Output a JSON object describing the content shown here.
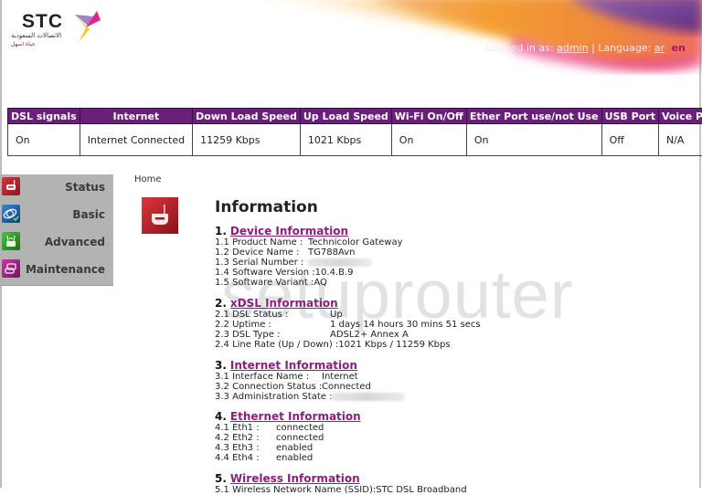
{
  "header": {
    "brand": "STC",
    "brand_arabic": "الاتصالات السعودية",
    "tagline_arabic": "حياة اسهل",
    "logged_in_prefix": "Logged in as:",
    "user": "admin",
    "separator": "|",
    "language_label": "Language:",
    "languages": [
      "ar",
      "en"
    ],
    "active_language": "en"
  },
  "status_table": {
    "headers": [
      "DSL signals",
      "Internet",
      "Down Load Speed",
      "Up Load Speed",
      "Wi-Fi On/Off",
      "Ether Port use/not Use",
      "USB Port",
      "Voice Port"
    ],
    "values": [
      "On",
      "Internet Connected",
      "11259 Kbps",
      "1021 Kbps",
      "On",
      "On",
      "Off",
      "N/A"
    ]
  },
  "sidebar": {
    "items": [
      {
        "label": "Status",
        "icon": "router-icon",
        "color": "#b0212b"
      },
      {
        "label": "Basic",
        "icon": "globe-check-icon",
        "color": "#1d5ea8"
      },
      {
        "label": "Advanced",
        "icon": "router-antenna-icon",
        "color": "#2e9a2a"
      },
      {
        "label": "Maintenance",
        "icon": "tools-icon",
        "color": "#a3248a"
      }
    ]
  },
  "main": {
    "breadcrumb": "Home",
    "title": "Information",
    "watermark": "setuprouter",
    "sections": [
      {
        "number": "1.",
        "title": "Device Information",
        "rows": [
          {
            "label": "1.1 Product Name :",
            "value": "Technicolor Gateway"
          },
          {
            "label": "1.2 Device Name :",
            "value": "TG788Avn"
          },
          {
            "label": "1.3 Serial Number :",
            "value": ""
          },
          {
            "label": "1.4 Software Version :",
            "value": "10.4.B.9"
          },
          {
            "label": "1.5 Software Variant :",
            "value": "AQ"
          }
        ]
      },
      {
        "number": "2.",
        "title": "xDSL Information",
        "rows": [
          {
            "label": "2.1 DSL Status :",
            "value": "Up"
          },
          {
            "label": "2.2 Uptime :",
            "value": "1 days 14 hours 30 mins 51 secs"
          },
          {
            "label": "2.3 DSL Type :",
            "value": "ADSL2+ Annex A"
          },
          {
            "label": "2.4 Line Rate (Up / Down) :",
            "value": "1021 Kbps / 11259 Kbps"
          }
        ]
      },
      {
        "number": "3.",
        "title": "Internet Information",
        "rows": [
          {
            "label": "3.1 Interface Name :",
            "value": "Internet"
          },
          {
            "label": "3.2 Connection Status :",
            "value": "Connected"
          },
          {
            "label": "3.3 Administration State :",
            "value": ""
          }
        ]
      },
      {
        "number": "4.",
        "title": "Ethernet Information",
        "rows": [
          {
            "label": "4.1 Eth1 :",
            "value": "connected"
          },
          {
            "label": "4.2 Eth2 :",
            "value": "connected"
          },
          {
            "label": "4.3 Eth3 :",
            "value": "enabled"
          },
          {
            "label": "4.4 Eth4 :",
            "value": "enabled"
          }
        ]
      },
      {
        "number": "5.",
        "title": "Wireless Information",
        "rows": [
          {
            "label": "5.1 Wireless Network Name (SSID):",
            "value": "STC DSL Broadband"
          }
        ]
      }
    ]
  }
}
